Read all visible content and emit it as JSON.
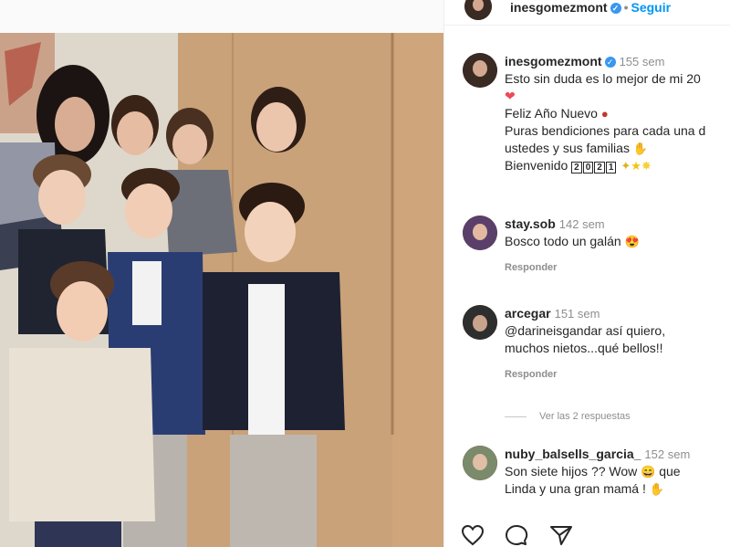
{
  "header": {
    "username": "inesgomezmont",
    "follow_label": "Seguir"
  },
  "caption": {
    "username": "inesgomezmont",
    "time": "155 sem",
    "line1": "Esto sin duda es lo mejor de mi 20",
    "line2": "Feliz Año Nuevo",
    "line3": "Puras bendiciones para cada una d",
    "line4": "ustedes y sus familias",
    "line5_text": "Bienvenido",
    "year_digits": [
      "2",
      "0",
      "2",
      "1"
    ]
  },
  "comments": [
    {
      "username": "stay.sob",
      "time": "142 sem",
      "text": "Bosco todo un galán",
      "reply_label": "Responder"
    },
    {
      "username": "arcegar",
      "time": "151 sem",
      "line1": "@darineisgandar así quiero,",
      "line2": "muchos nietos...qué bellos!!",
      "reply_label": "Responder",
      "view_replies": "Ver las 2 respuestas"
    },
    {
      "username": "nuby_balsells_garcia_",
      "time": "152 sem",
      "line1": "Son siete hijos ?? Wow",
      "line1b": "que",
      "line2": "Linda y una gran mamá !"
    }
  ],
  "icons": {
    "verified": "verified-badge-icon",
    "like": "heart-icon",
    "comment": "comment-icon",
    "share": "paper-plane-icon"
  },
  "colors": {
    "accent": "#0095f6",
    "verified": "#3897f0",
    "like": "#ed4956"
  }
}
